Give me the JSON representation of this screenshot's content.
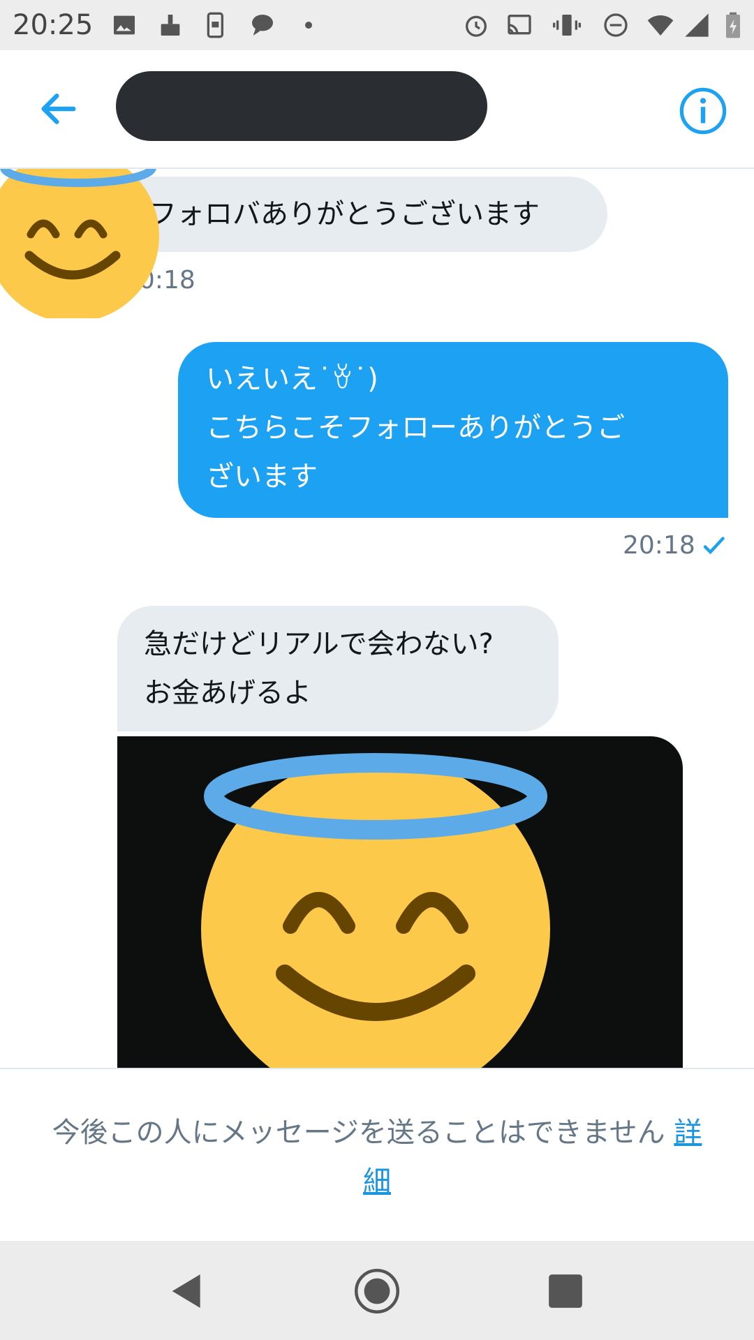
{
  "status_bar": {
    "time": "20:25",
    "left_icons": [
      "image-icon",
      "broom-icon",
      "phone-lock-icon",
      "chat-icon",
      "dot-icon"
    ],
    "right_icons": [
      "alarm-icon",
      "cast-icon",
      "vibrate-icon",
      "dnd-icon",
      "wifi-icon",
      "signal-icon",
      "battery-icon"
    ]
  },
  "header": {
    "back_icon": "arrow-left-icon",
    "title_redacted": "",
    "info_icon": "info-icon",
    "accent_color": "#1da1f2"
  },
  "messages": [
    {
      "direction": "in",
      "text": "フォロバありがとうございます",
      "time": "20:18"
    },
    {
      "direction": "out",
      "lines": [
        "いえいえ˙ꈊ˙)",
        "こちらこそフォローありがとうご",
        "ざいます"
      ],
      "time": "20:18",
      "status": "read-check-icon"
    },
    {
      "direction": "in",
      "lines": [
        "急だけどリアルで会わない?",
        "お金あげるよ"
      ],
      "attachment": "image"
    }
  ],
  "footer": {
    "notice": "今後この人にメッセージを送ることはできません",
    "link_label_1": "詳",
    "link_label_2": "細"
  },
  "nav_bar": {
    "buttons": [
      "back-triangle-icon",
      "home-circle-icon",
      "recents-square-icon"
    ]
  }
}
